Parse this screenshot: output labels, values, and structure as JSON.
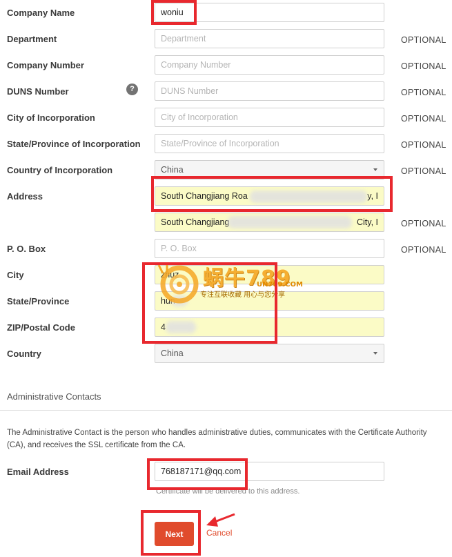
{
  "form": {
    "company_name": {
      "label": "Company Name",
      "value": "woniu"
    },
    "department": {
      "label": "Department",
      "placeholder": "Department",
      "optional": "OPTIONAL"
    },
    "company_number": {
      "label": "Company Number",
      "placeholder": "Company Number",
      "optional": "OPTIONAL"
    },
    "duns_number": {
      "label": "DUNS Number",
      "placeholder": "DUNS Number",
      "optional": "OPTIONAL",
      "help": "?"
    },
    "city_of_incorporation": {
      "label": "City of Incorporation",
      "placeholder": "City of Incorporation",
      "optional": "OPTIONAL"
    },
    "state_of_incorporation": {
      "label": "State/Province of Incorporation",
      "placeholder": "State/Province of Incorporation",
      "optional": "OPTIONAL"
    },
    "country_of_incorporation": {
      "label": "Country of Incorporation",
      "value": "China",
      "optional": "OPTIONAL"
    },
    "address": {
      "label": "Address",
      "line1_start": "South Changjiang Roa",
      "line1_end": "y, I",
      "line2_start": "South Changjiang",
      "line2_end": "City, I",
      "line2_optional": "OPTIONAL"
    },
    "po_box": {
      "label": "P. O. Box",
      "placeholder": "P. O. Box",
      "optional": "OPTIONAL"
    },
    "city": {
      "label": "City",
      "value": "zhuz"
    },
    "state_province": {
      "label": "State/Province",
      "value": "hun"
    },
    "zip": {
      "label": "ZIP/Postal Code",
      "value": "4"
    },
    "country": {
      "label": "Country",
      "value": "China"
    }
  },
  "admin": {
    "title": "Administrative Contacts",
    "description": "The Administrative Contact is the person who handles administrative duties, communicates with the Certificate Authority (CA), and receives the SSL certificate from the CA.",
    "email_label": "Email Address",
    "email_value": "768187171@qq.com",
    "email_hint": "Certificate will be delivered to this address."
  },
  "actions": {
    "next_label": "Next",
    "cancel_label": "Cancel"
  },
  "watermark": {
    "brand": "蜗牛789",
    "domain": "UN789.COM",
    "slogan": "专注互联收藏   用心与您分享"
  },
  "colors": {
    "accent": "#e04b2c",
    "highlight_box": "#e8282e",
    "autofill": "#fbfbc6"
  }
}
